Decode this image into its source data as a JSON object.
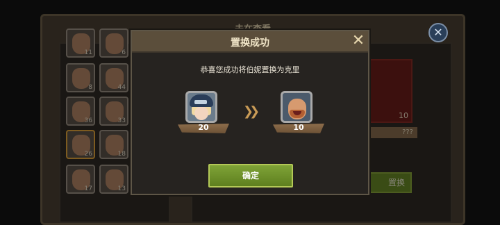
{
  "background": {
    "title": "未在查看",
    "thumbs": [
      {
        "level": "11"
      },
      {
        "level": "6"
      },
      {
        "level": "8"
      },
      {
        "level": "44"
      },
      {
        "level": "36"
      },
      {
        "level": "33"
      },
      {
        "level": "26"
      },
      {
        "level": "18"
      },
      {
        "level": "17"
      },
      {
        "level": "13"
      }
    ],
    "card_level": "10",
    "card_name": "???",
    "button_label": "置换",
    "close_glyph": "✕"
  },
  "dialog": {
    "title": "置换成功",
    "close_glyph": "✕",
    "message": "恭喜您成功将伯妮置换为克里",
    "from": {
      "name_hint": "伯妮",
      "level": "20"
    },
    "to": {
      "name_hint": "克里",
      "level": "10"
    },
    "arrow_glyph": "❯❯",
    "confirm_label": "确定"
  }
}
